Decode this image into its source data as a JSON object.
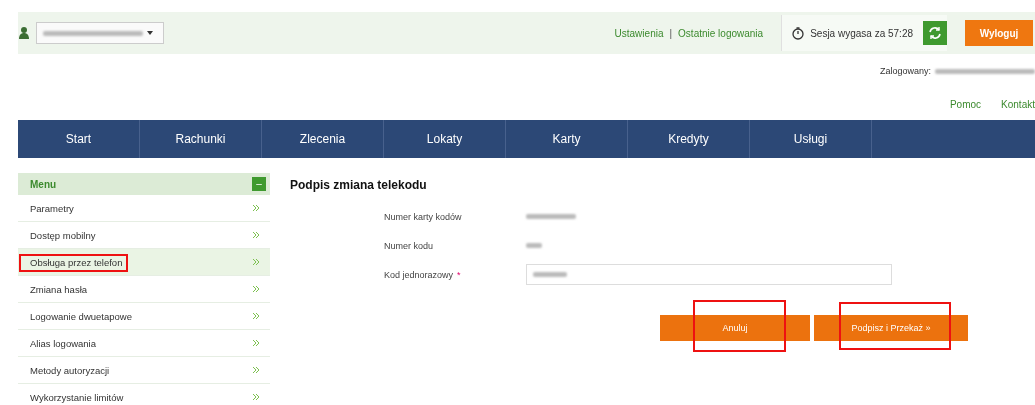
{
  "top_bar": {
    "links": [
      "Ustawienia",
      "Ostatnie logowania"
    ],
    "separator": "|",
    "session": "Sesja wygasa za 57:28",
    "logout": "Wyloguj"
  },
  "logged_in": {
    "label": "Zalogowany:"
  },
  "help_links": [
    "Pomoc",
    "Kontakt"
  ],
  "nav": [
    "Start",
    "Rachunki",
    "Zlecenia",
    "Lokaty",
    "Karty",
    "Kredyty",
    "Usługi"
  ],
  "sidebar": {
    "title": "Menu",
    "collapse": "–",
    "items": [
      {
        "label": "Parametry",
        "selected": false,
        "highlighted": false
      },
      {
        "label": "Dostęp mobilny",
        "selected": false,
        "highlighted": false
      },
      {
        "label": "Obsługa przez telefon",
        "selected": true,
        "highlighted": true
      },
      {
        "label": "Zmiana hasła",
        "selected": false,
        "highlighted": false
      },
      {
        "label": "Logowanie dwuetapowe",
        "selected": false,
        "highlighted": false
      },
      {
        "label": "Alias logowania",
        "selected": false,
        "highlighted": false
      },
      {
        "label": "Metody autoryzacji",
        "selected": false,
        "highlighted": false
      },
      {
        "label": "Wykorzystanie limitów",
        "selected": false,
        "highlighted": false
      }
    ]
  },
  "form": {
    "title": "Podpis zmiana telekodu",
    "fields": [
      {
        "kind": "readonly",
        "label": "Numer karty kodów",
        "required": false
      },
      {
        "kind": "readonly",
        "label": "Numer kodu",
        "required": false
      },
      {
        "kind": "input",
        "label": "Kod jednorazowy",
        "required": true,
        "required_mark": "*"
      }
    ],
    "buttons": [
      {
        "label": "Anuluj",
        "highlighted": true
      },
      {
        "label": "Podpisz i Przekaż »",
        "highlighted": true
      }
    ]
  }
}
